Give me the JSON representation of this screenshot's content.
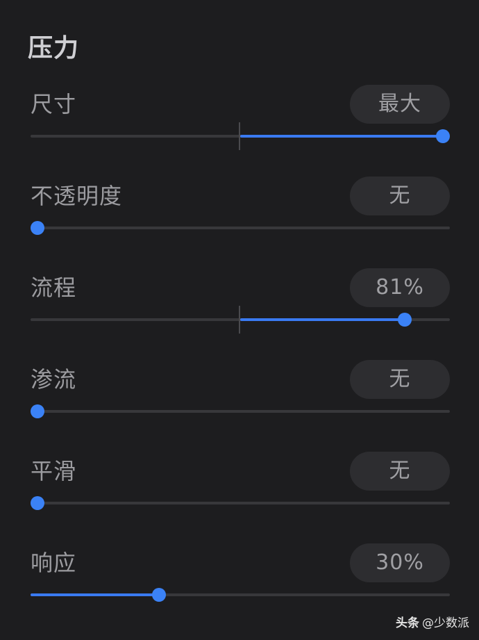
{
  "section": {
    "title": "压力"
  },
  "rows": [
    {
      "label": "尺寸",
      "value": "最大",
      "slider": {
        "bipolar": true,
        "level": 1.0
      }
    },
    {
      "label": "不透明度",
      "value": "无",
      "slider": {
        "bipolar": false,
        "level": 0.0
      }
    },
    {
      "label": "流程",
      "value": "81%",
      "slider": {
        "bipolar": true,
        "level": 0.81
      }
    },
    {
      "label": "渗流",
      "value": "无",
      "slider": {
        "bipolar": false,
        "level": 0.0
      }
    },
    {
      "label": "平滑",
      "value": "无",
      "slider": {
        "bipolar": false,
        "level": 0.0
      }
    },
    {
      "label": "响应",
      "value": "30%",
      "slider": {
        "bipolar": false,
        "level": 0.3
      }
    }
  ],
  "colors": {
    "accent": "#3b82f6",
    "track": "#38383b",
    "pill": "#2d2d30",
    "background": "#1d1d1f"
  },
  "watermark": {
    "brand": "头条",
    "handle": "@少数派"
  }
}
